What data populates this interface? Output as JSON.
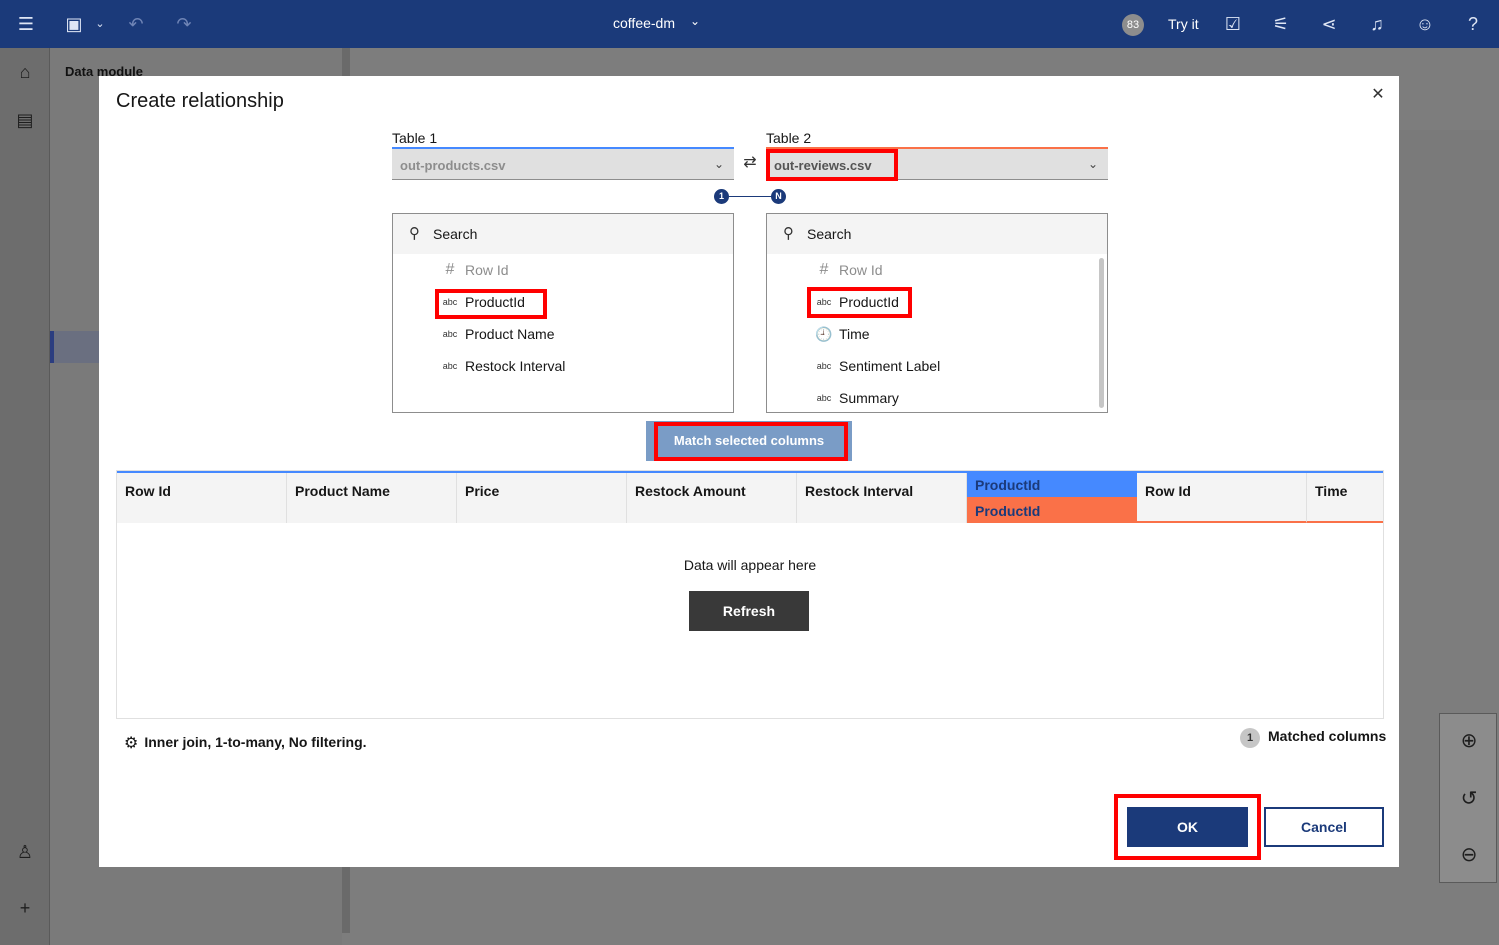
{
  "topbar": {
    "title": "coffee-dm",
    "badge_count": "83",
    "try_it": "Try it",
    "icons": [
      "menu-icon",
      "save-icon",
      "chevron-down-icon",
      "undo-icon",
      "redo-icon",
      "checklist-icon",
      "settings-sliders-icon",
      "share-icon",
      "notification-icon",
      "user-icon",
      "help-icon"
    ]
  },
  "left_panel": {
    "title": "Data module"
  },
  "modal": {
    "title": "Create relationship",
    "table1": {
      "label": "Table 1",
      "value": "out-products.csv",
      "search_placeholder": "Search",
      "columns": [
        {
          "icon": "#",
          "name": "Row Id",
          "muted": true
        },
        {
          "icon": "abc",
          "name": "ProductId",
          "muted": false
        },
        {
          "icon": "abc",
          "name": "Product Name",
          "muted": false
        },
        {
          "icon": "abc",
          "name": "Restock Interval",
          "muted": false
        }
      ]
    },
    "table2": {
      "label": "Table 2",
      "value": "out-reviews.csv",
      "search_placeholder": "Search",
      "columns": [
        {
          "icon": "#",
          "name": "Row Id",
          "muted": true
        },
        {
          "icon": "abc",
          "name": "ProductId",
          "muted": false
        },
        {
          "icon": "clock",
          "name": "Time",
          "muted": false
        },
        {
          "icon": "abc",
          "name": "Sentiment Label",
          "muted": false
        },
        {
          "icon": "abc",
          "name": "Summary",
          "muted": false
        }
      ]
    },
    "cardinality": {
      "left": "1",
      "right": "N"
    },
    "match_button": "Match selected columns",
    "grid": {
      "left_headers": [
        "Row Id",
        "Product Name",
        "Price",
        "Restock Amount",
        "Restock Interval"
      ],
      "key_header_top": "ProductId",
      "key_header_bottom": "ProductId",
      "right_headers": [
        "Row Id",
        "Time"
      ],
      "empty_message": "Data will appear here",
      "refresh_button": "Refresh"
    },
    "summary": "Inner join, 1-to-many, No filtering.",
    "matched_count": "1",
    "matched_label": "Matched columns",
    "ok_button": "OK",
    "cancel_button": "Cancel"
  },
  "colors": {
    "brand_blue": "#1b3a7a",
    "table1_accent": "#4589ff",
    "table2_accent": "#fa7148",
    "highlight": "#ff0000"
  }
}
